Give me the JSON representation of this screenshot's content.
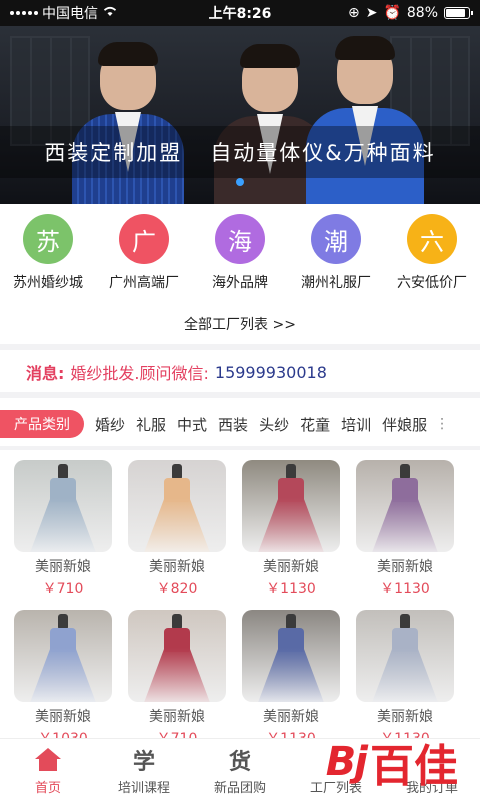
{
  "status_bar": {
    "carrier": "中国电信",
    "time": "上午8:26",
    "battery": "88%",
    "battery_level": 0.88
  },
  "banner": {
    "caption_left": "西装定制加盟",
    "caption_right": "自动量体仪&万种面料"
  },
  "factories": [
    {
      "char": "苏",
      "label": "苏州婚纱城",
      "color": "#7cc36a"
    },
    {
      "char": "广",
      "label": "广州高端厂",
      "color": "#ef5363"
    },
    {
      "char": "海",
      "label": "海外品牌",
      "color": "#b06be0"
    },
    {
      "char": "潮",
      "label": "潮州礼服厂",
      "color": "#7f7be3"
    },
    {
      "char": "六",
      "label": "六安低价厂",
      "color": "#f7b217"
    }
  ],
  "all_factories_link": "全部工厂列表 >>",
  "message": {
    "title": "消息:",
    "text": "婚纱批发.顾问微信:",
    "number": "15999930018"
  },
  "categories": {
    "pill": "产品类别",
    "items": [
      "婚纱",
      "礼服",
      "中式",
      "西装",
      "头纱",
      "花童",
      "培训",
      "伴娘服"
    ],
    "more": "⋮"
  },
  "products": [
    {
      "name": "美丽新娘",
      "price": "￥710",
      "bg": "#c7cbc9",
      "dress": "#9fb2c6"
    },
    {
      "name": "美丽新娘",
      "price": "￥820",
      "bg": "#d6d3d2",
      "dress": "#e6b78a"
    },
    {
      "name": "美丽新娘",
      "price": "￥1130",
      "bg": "#8f8a80",
      "dress": "#b4485a"
    },
    {
      "name": "美丽新娘",
      "price": "￥1130",
      "bg": "#b7b1ab",
      "dress": "#8e6d9c"
    },
    {
      "name": "美丽新娘",
      "price": "￥1030",
      "bg": "#b9b4ad",
      "dress": "#8fa2cf"
    },
    {
      "name": "美丽新娘",
      "price": "￥710",
      "bg": "#cfc7c0",
      "dress": "#b23a4c"
    },
    {
      "name": "美丽新娘",
      "price": "￥1130",
      "bg": "#8b8782",
      "dress": "#596aa6"
    },
    {
      "name": "美丽新娘",
      "price": "￥1130",
      "bg": "#c2bfbb",
      "dress": "#a9b2c6"
    }
  ],
  "nav": [
    {
      "icon": "home-icon",
      "glyph": "",
      "label": "首页"
    },
    {
      "icon": "study-icon",
      "glyph": "学",
      "label": "培训课程"
    },
    {
      "icon": "goods-icon",
      "glyph": "货",
      "label": "新品团购"
    },
    {
      "icon": "factory-icon",
      "glyph": "",
      "label": "工厂列表"
    },
    {
      "icon": "order-icon",
      "glyph": "",
      "label": "我的订单"
    }
  ],
  "watermark": {
    "logo": "Bj",
    "text": "百佳"
  }
}
